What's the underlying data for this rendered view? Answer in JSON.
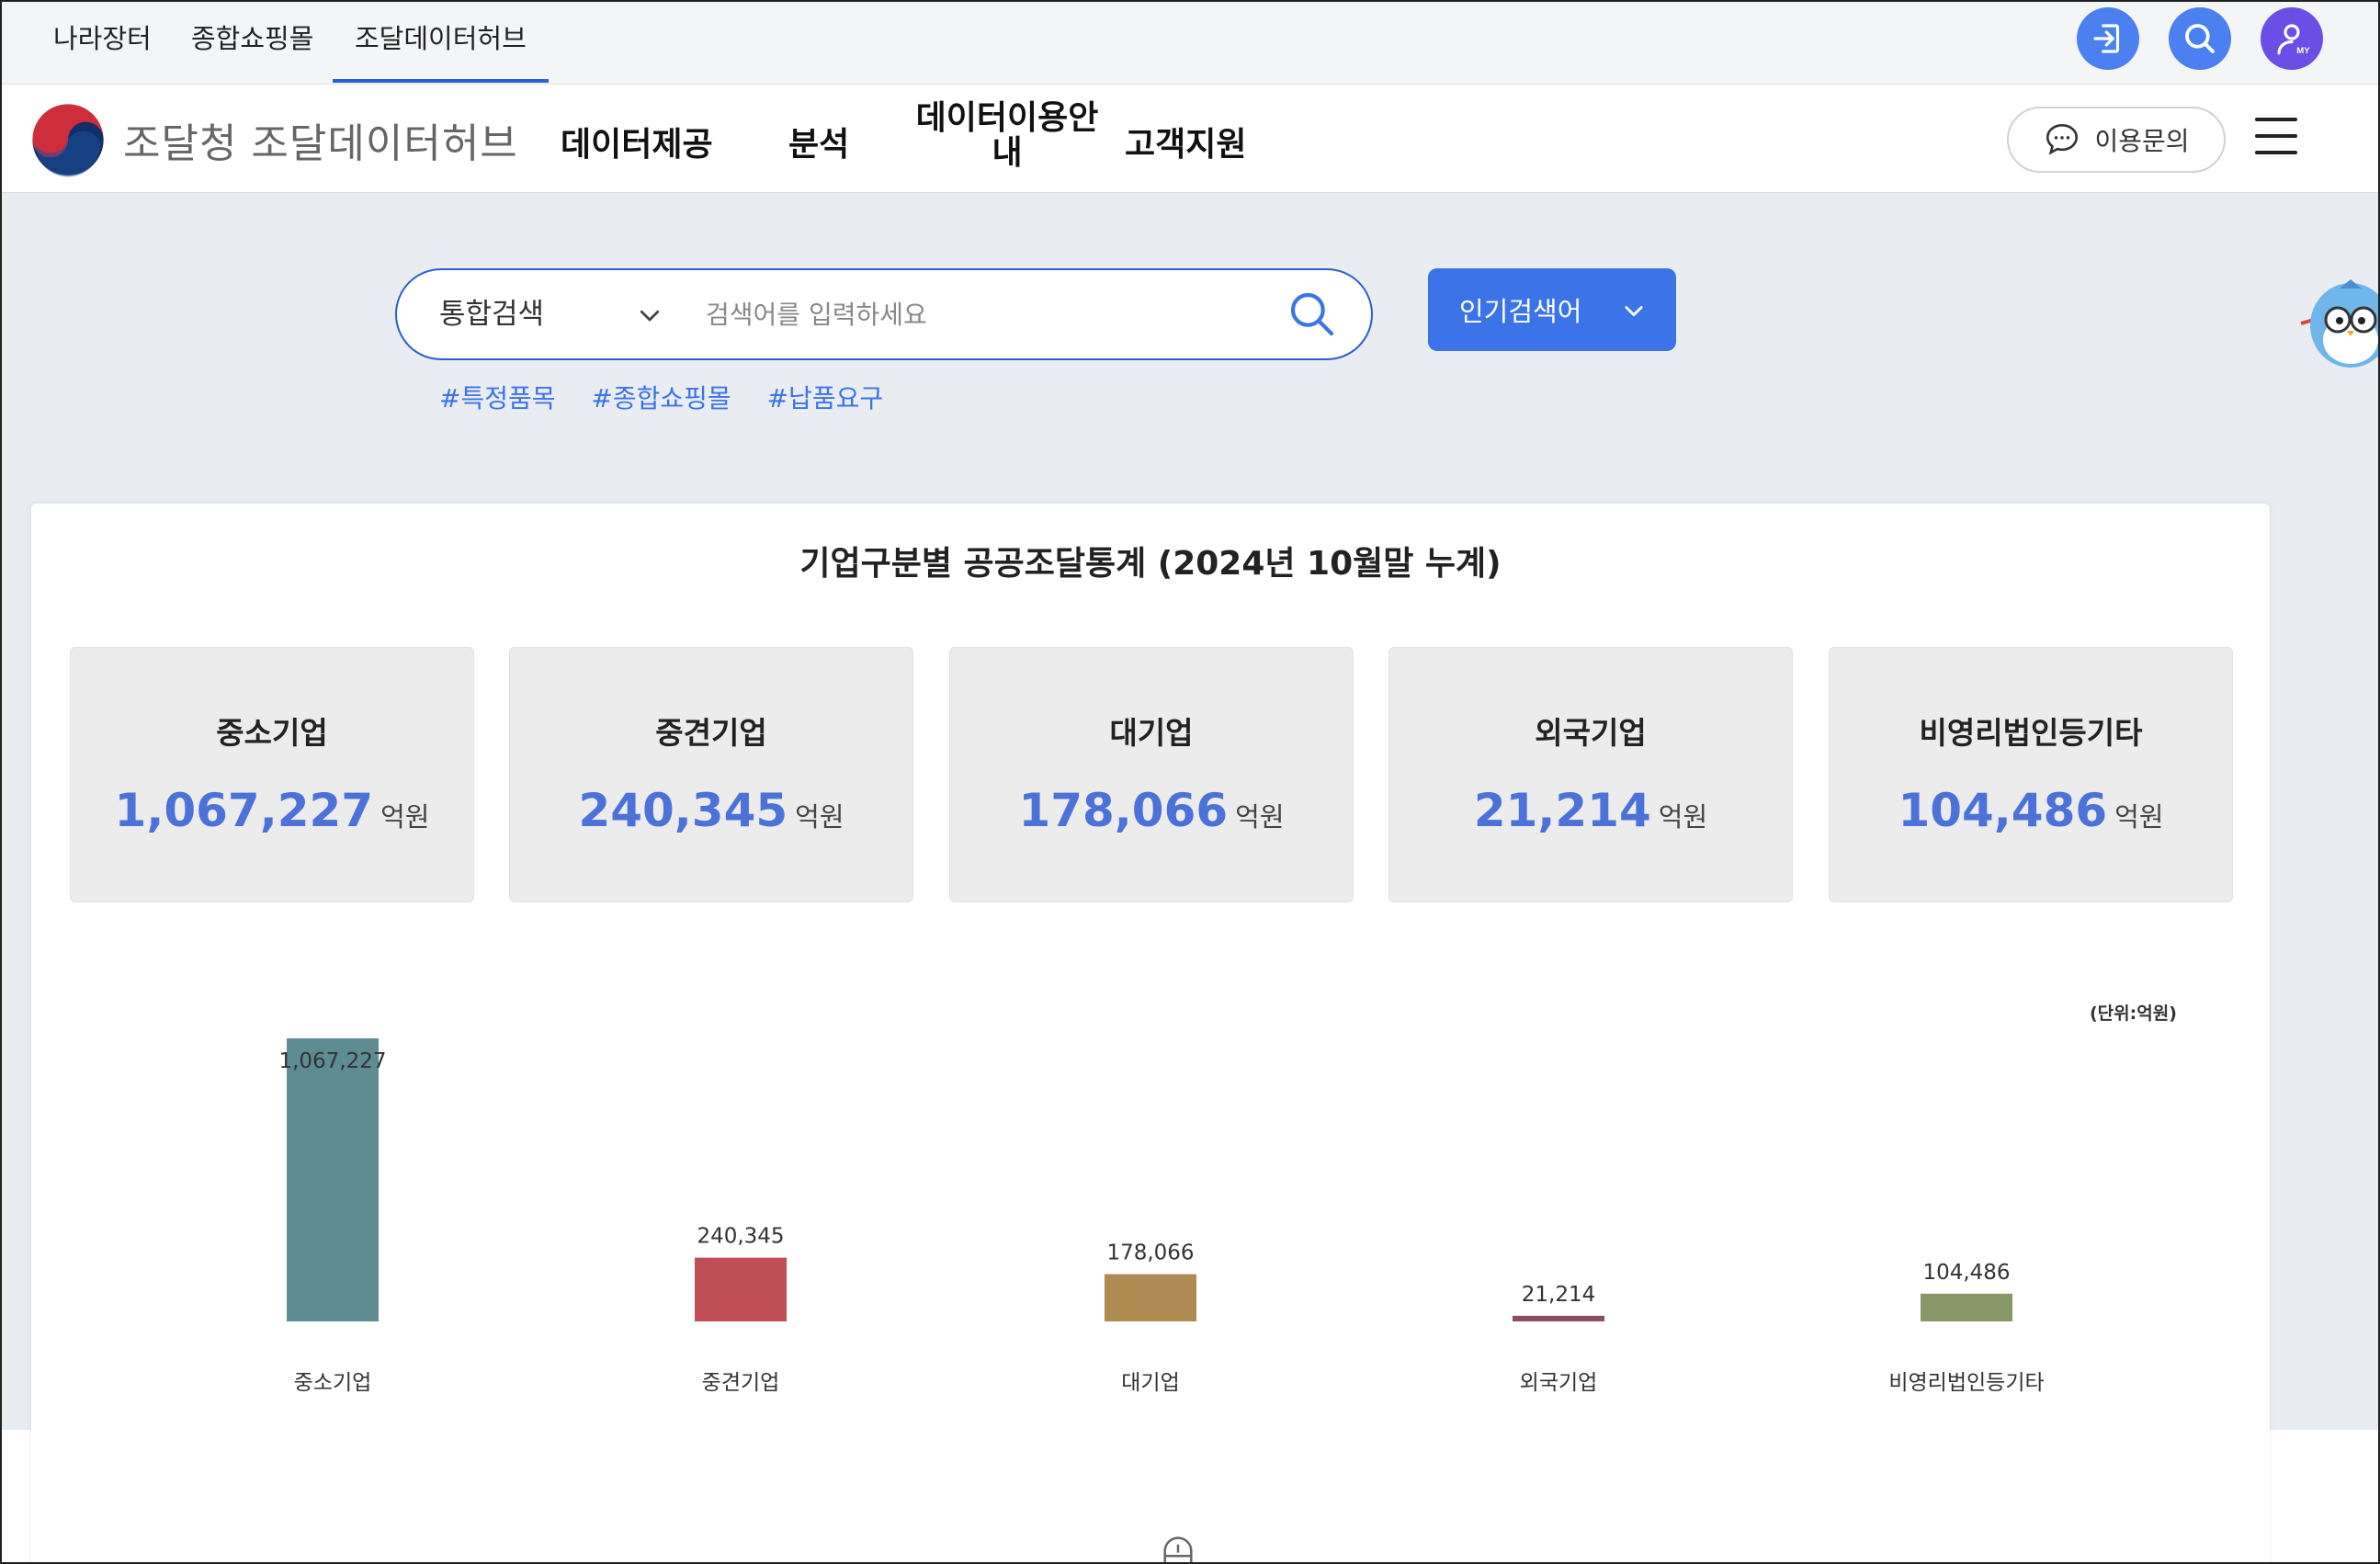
{
  "utility_tabs": [
    "나라장터",
    "종합쇼핑몰",
    "조달데이터허브"
  ],
  "active_tab": "조달데이터허브",
  "header": {
    "site_title": "조달청 조달데이터허브",
    "nav": [
      "데이터제공",
      "분석",
      "데이터이용안내",
      "고객지원"
    ],
    "inquiry_label": "이용문의"
  },
  "icons": {
    "login": "login-icon",
    "search": "search-icon",
    "my": "my-page-icon",
    "menu": "hamburger-icon",
    "chat": "chat-icon"
  },
  "colors": {
    "accent": "#3b73e8",
    "login_button": "#4a80f0",
    "search_button": "#4a80f0",
    "my_button": "#6a4ee6"
  },
  "search": {
    "select_value": "통합검색",
    "placeholder": "검색어를 입력하세요",
    "popular_label": "인기검색어",
    "hashtags": [
      "#특정품목",
      "#종합쇼핑몰",
      "#납품요구"
    ]
  },
  "stats": {
    "title": "기업구분별 공공조달통계 (2024년 10월말 누계)",
    "unit_label": "억원",
    "unit_note": "(단위:억원)",
    "cards": [
      {
        "label": "중소기업",
        "value": "1,067,227"
      },
      {
        "label": "중견기업",
        "value": "240,345"
      },
      {
        "label": "대기업",
        "value": "178,066"
      },
      {
        "label": "외국기업",
        "value": "21,214"
      },
      {
        "label": "비영리법인등기타",
        "value": "104,486"
      }
    ]
  },
  "chart_data": {
    "type": "bar",
    "categories": [
      "중소기업",
      "중견기업",
      "대기업",
      "외국기업",
      "비영리법인등기타"
    ],
    "values": [
      1067227,
      240345,
      178066,
      21214,
      104486
    ],
    "data_labels": [
      "1,067,227",
      "240,345",
      "178,066",
      "21,214",
      "104,486"
    ],
    "colors": [
      "#5f8b93",
      "#bf4f55",
      "#b08a53",
      "#8a4d63",
      "#879767"
    ],
    "ylim": [
      0,
      1067227
    ],
    "grid": false,
    "legend": "none"
  }
}
